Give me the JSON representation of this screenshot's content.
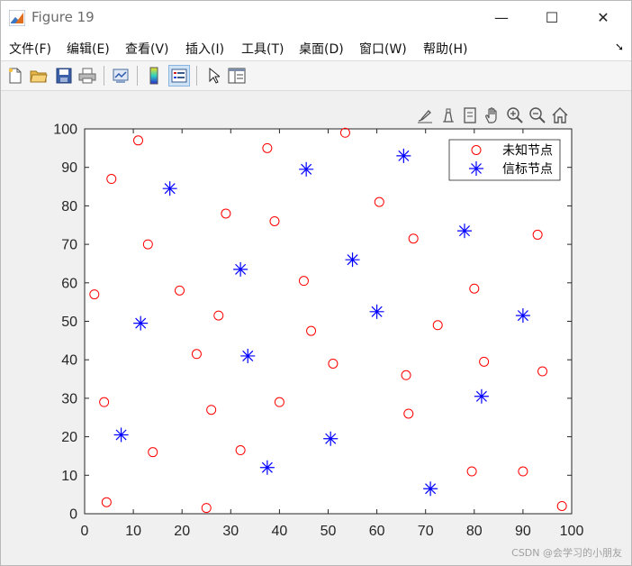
{
  "window": {
    "title": "Figure 19",
    "controls": {
      "minimize": "—",
      "maximize": "☐",
      "close": "✕"
    }
  },
  "menu": [
    {
      "label": "文件(F)"
    },
    {
      "label": "编辑(E)"
    },
    {
      "label": "查看(V)"
    },
    {
      "label": "插入(I)"
    },
    {
      "label": "工具(T)"
    },
    {
      "label": "桌面(D)"
    },
    {
      "label": "窗口(W)"
    },
    {
      "label": "帮助(H)"
    }
  ],
  "menu_dock_icon": "dock-arrow-icon",
  "toolbar_icons": [
    "new-figure-icon",
    "open-file-icon",
    "save-icon",
    "print-icon",
    "link-plot-icon",
    "insert-colorbar-icon",
    "insert-legend-icon",
    "edit-plot-arrow-icon",
    "property-inspector-icon"
  ],
  "axes_toolbar_icons": [
    "brush-icon",
    "data-tips-icon",
    "export-icon",
    "pan-icon",
    "zoom-in-icon",
    "zoom-out-icon",
    "home-icon"
  ],
  "watermark": "CSDN @会学习的小朋友",
  "chart_data": {
    "type": "scatter",
    "title": "",
    "xlabel": "",
    "ylabel": "",
    "xlim": [
      0,
      100
    ],
    "ylim": [
      0,
      100
    ],
    "xticks": [
      0,
      10,
      20,
      30,
      40,
      50,
      60,
      70,
      80,
      90,
      100
    ],
    "yticks": [
      0,
      10,
      20,
      30,
      40,
      50,
      60,
      70,
      80,
      90,
      100
    ],
    "grid": false,
    "legend_position": "top-right",
    "series": [
      {
        "name": "未知节点",
        "marker": "circle",
        "color": "#ff0000",
        "points": [
          [
            2,
            57
          ],
          [
            4,
            29
          ],
          [
            4.5,
            3
          ],
          [
            5.5,
            87
          ],
          [
            11,
            97
          ],
          [
            13,
            70
          ],
          [
            14,
            16
          ],
          [
            19.5,
            58
          ],
          [
            23,
            41.5
          ],
          [
            25,
            1.5
          ],
          [
            26,
            27
          ],
          [
            27.5,
            51.5
          ],
          [
            29,
            78
          ],
          [
            32,
            16.5
          ],
          [
            37.5,
            95
          ],
          [
            39,
            76
          ],
          [
            40,
            29
          ],
          [
            45,
            60.5
          ],
          [
            46.5,
            47.5
          ],
          [
            51,
            39
          ],
          [
            53.5,
            99
          ],
          [
            60.5,
            81
          ],
          [
            66,
            36
          ],
          [
            66.5,
            26
          ],
          [
            67.5,
            71.5
          ],
          [
            72.5,
            49
          ],
          [
            79.5,
            11
          ],
          [
            80,
            58.5
          ],
          [
            82,
            39.5
          ],
          [
            90,
            11
          ],
          [
            93,
            72.5
          ],
          [
            94,
            37
          ],
          [
            98,
            2
          ]
        ]
      },
      {
        "name": "信标节点",
        "marker": "asterisk",
        "color": "#0000ff",
        "points": [
          [
            7.5,
            20.5
          ],
          [
            11.5,
            49.5
          ],
          [
            17.5,
            84.5
          ],
          [
            32,
            63.5
          ],
          [
            33.5,
            41
          ],
          [
            37.5,
            12
          ],
          [
            45.5,
            89.5
          ],
          [
            50.5,
            19.5
          ],
          [
            55,
            66
          ],
          [
            60,
            52.5
          ],
          [
            65.5,
            93
          ],
          [
            71,
            6.5
          ],
          [
            78,
            73.5
          ],
          [
            81.5,
            30.5
          ],
          [
            90,
            51.5
          ]
        ]
      }
    ]
  }
}
